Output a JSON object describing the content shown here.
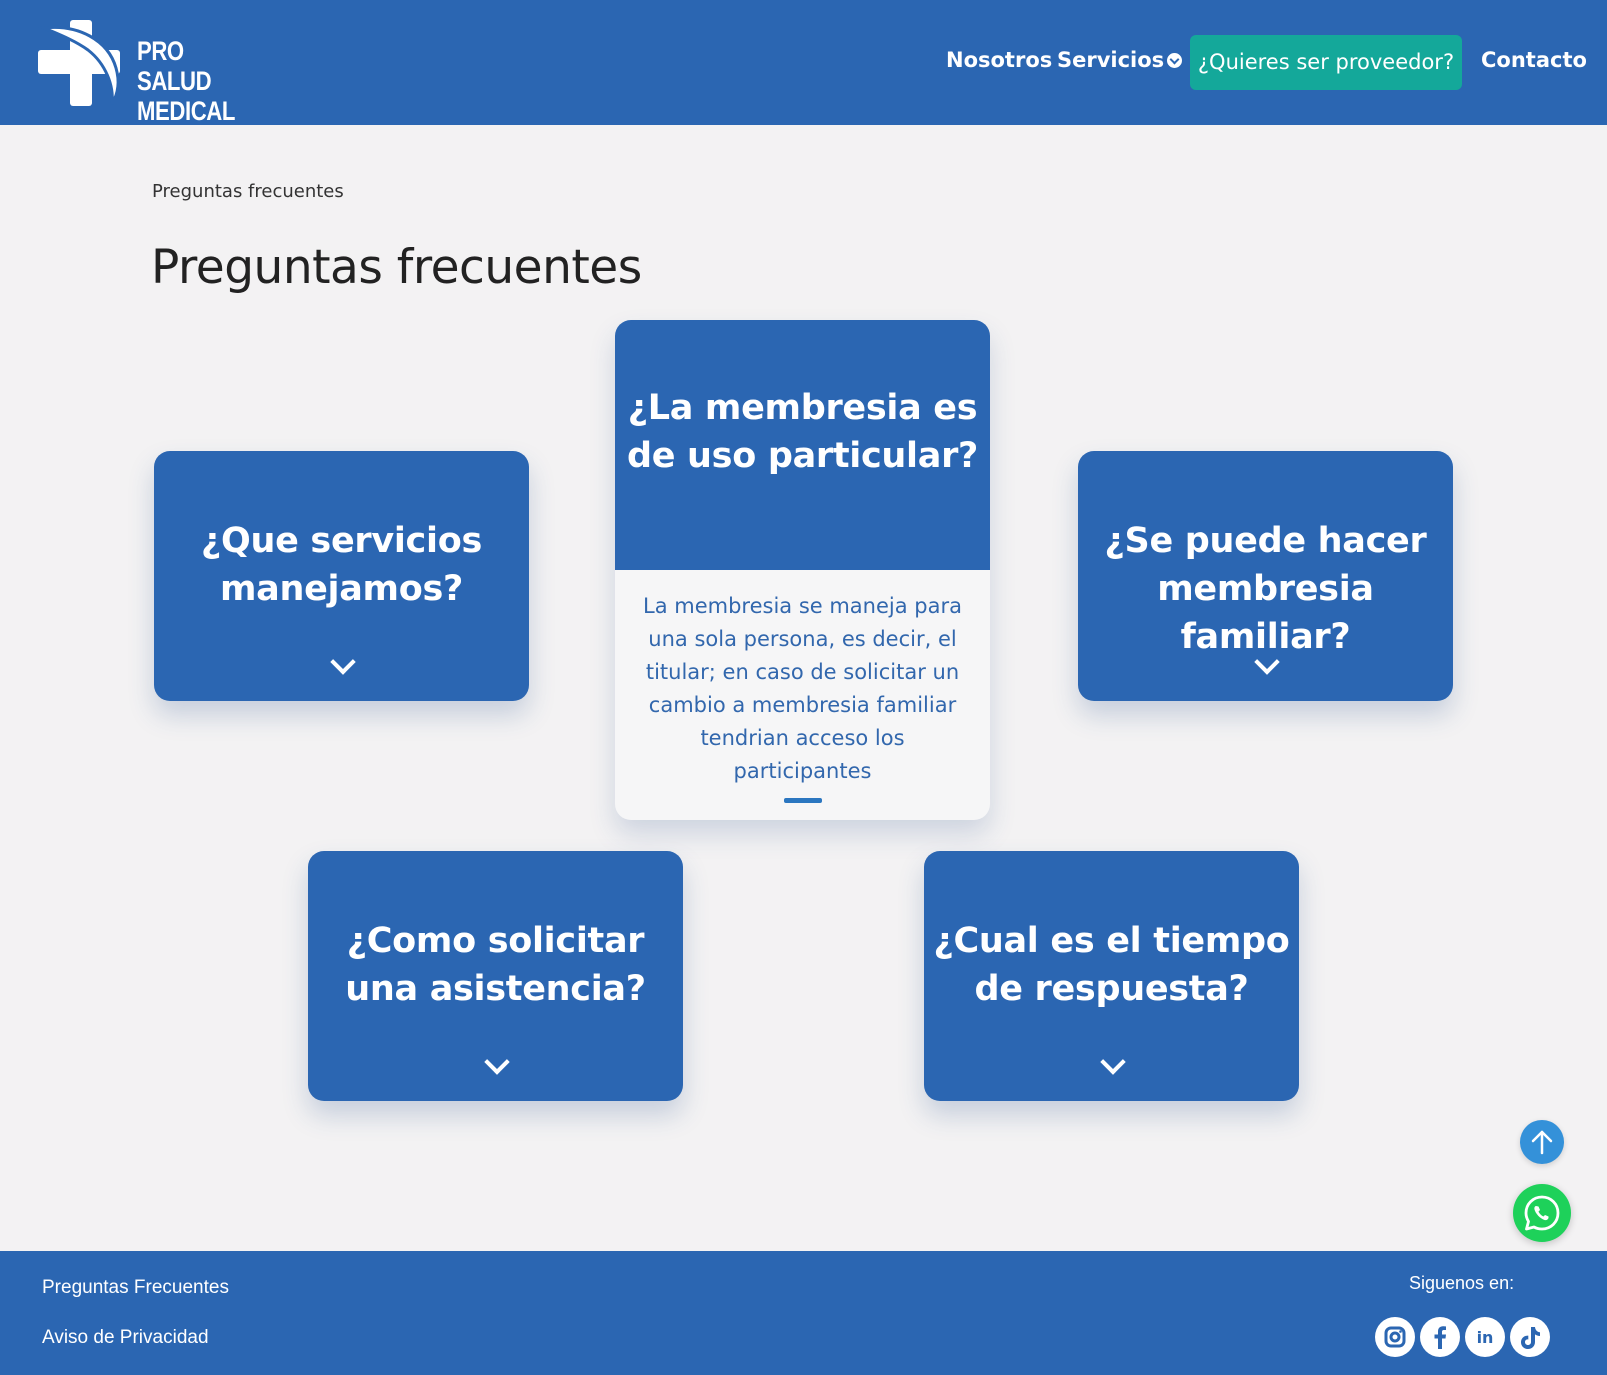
{
  "header": {
    "logo": {
      "line1": "PRO SALUD",
      "line2": "MEDICAL",
      "icon": "medical-cross-logo"
    },
    "nav": {
      "nosotros": "Nosotros",
      "servicios": "Servicios",
      "proveedor": "¿Quieres ser proveedor?",
      "contacto": "Contacto"
    }
  },
  "breadcrumb": "Preguntas frecuentes",
  "page_title": "Preguntas frecuentes",
  "faq": {
    "servicios": {
      "question": "¿Que servicios manejamos?",
      "icon": "chevron-down-icon"
    },
    "membresia_particular": {
      "question": "¿La membresia es de uso particular?",
      "answer": "La membresia se maneja para una sola persona, es decir, el titular; en caso de solicitar un cambio a membresia familiar tendrian acceso los participantes",
      "expanded": true
    },
    "membresia_familiar": {
      "question": "¿Se puede hacer membresia familiar?",
      "icon": "chevron-down-icon"
    },
    "asistencia": {
      "question": "¿Como solicitar una asistencia?",
      "icon": "chevron-down-icon"
    },
    "tiempo_respuesta": {
      "question": "¿Cual es el tiempo de respuesta?",
      "icon": "chevron-down-icon"
    }
  },
  "floating": {
    "scroll_top_icon": "arrow-up-icon",
    "whatsapp_icon": "whatsapp-icon"
  },
  "footer": {
    "links": {
      "faq": "Preguntas Frecuentes",
      "aviso": "Aviso de Privacidad"
    },
    "follow_label": "Siguenos en:",
    "social": [
      "instagram-icon",
      "facebook-icon",
      "linkedin-icon",
      "tiktok-icon"
    ]
  },
  "colors": {
    "brand_blue": "#2b66b2",
    "accent_teal": "#14a89a",
    "background": "#f3f2f3",
    "whatsapp_green": "#1ed15a",
    "scroll_top_blue": "#3491d9"
  }
}
